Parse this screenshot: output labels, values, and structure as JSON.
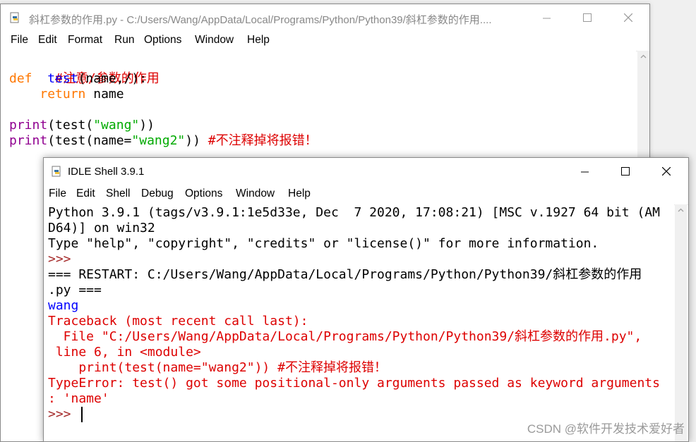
{
  "editor": {
    "title": "斜杠参数的作用.py - C:/Users/Wang/AppData/Local/Programs/Python/Python39/斜杠参数的作用....",
    "menu": [
      "File",
      "Edit",
      "Format",
      "Run",
      "Options",
      "Window",
      "Help"
    ],
    "code": {
      "l1": "#注意/参数的作用",
      "l2_kw": "def",
      "l2_sp": "  ",
      "l2_name": "test",
      "l2_rest": "(name,/):",
      "l3_indent": "    ",
      "l3_kw": "return",
      "l3_rest": " name",
      "l5_bi": "print",
      "l5_a": "(test(",
      "l5_str": "\"wang\"",
      "l5_b": "))",
      "l6_bi": "print",
      "l6_a": "(test(name=",
      "l6_str": "\"wang2\"",
      "l6_b": ")) ",
      "l6_cm": "#不注释掉将报错！"
    }
  },
  "shell": {
    "title": "IDLE Shell 3.9.1",
    "menu": [
      "File",
      "Edit",
      "Shell",
      "Debug",
      "Options",
      "Window",
      "Help"
    ],
    "lines": {
      "l1": "Python 3.9.1 (tags/v3.9.1:1e5d33e, Dec  7 2020, 17:08:21) [MSC v.1927 64 bit (AM",
      "l2": "D64)] on win32",
      "l3": "Type \"help\", \"copyright\", \"credits\" or \"license()\" for more information.",
      "l4": ">>> ",
      "l5": "=== RESTART: C:/Users/Wang/AppData/Local/Programs/Python/Python39/斜杠参数的作用",
      "l6": ".py ===",
      "l7": "wang",
      "l8": "Traceback (most recent call last):",
      "l9": "  File \"C:/Users/Wang/AppData/Local/Programs/Python/Python39/斜杠参数的作用.py\",",
      "l10": " line 6, in <module>",
      "l11": "    print(test(name=\"wang2\")) #不注释掉将报错！",
      "l12": "TypeError: test() got some positional-only arguments passed as keyword arguments",
      "l13": ": 'name'",
      "l14": ">>> "
    }
  },
  "watermark": "CSDN @软件开发技术爱好者",
  "window_controls": {
    "minimize": "—",
    "maximize": "☐",
    "close": "✕"
  },
  "icons": [
    "python-file-icon",
    "minimize-icon",
    "maximize-icon",
    "close-icon",
    "scroll-up-icon"
  ]
}
